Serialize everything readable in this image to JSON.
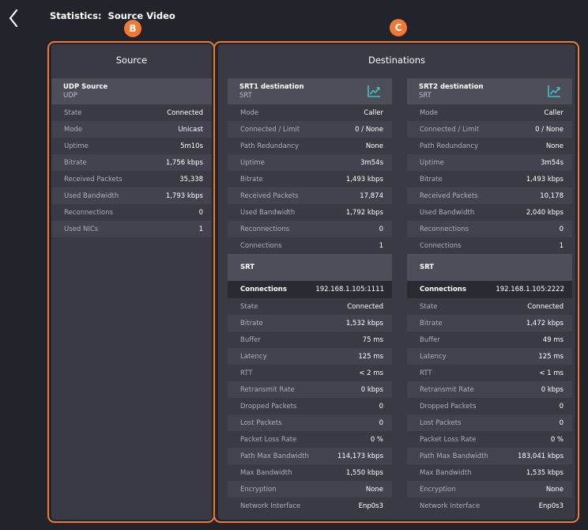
{
  "header": {
    "title_label": "Statistics:",
    "title_name": "Source Video"
  },
  "callouts": {
    "b": "B",
    "c": "C"
  },
  "colors": {
    "accent": "#f07a33",
    "chart_icon": "#37c6c6",
    "background": "#23232b"
  },
  "source": {
    "title": "Source",
    "card": {
      "name": "UDP Source",
      "type": "UDP",
      "rows": [
        {
          "label": "State",
          "value": "Connected"
        },
        {
          "label": "Mode",
          "value": "Unicast"
        },
        {
          "label": "Uptime",
          "value": "5m10s"
        },
        {
          "label": "Bitrate",
          "value": "1,756 kbps"
        },
        {
          "label": "Received Packets",
          "value": "35,338"
        },
        {
          "label": "Used Bandwidth",
          "value": "1,793 kbps"
        },
        {
          "label": "Reconnections",
          "value": "0"
        },
        {
          "label": "Used NICs",
          "value": "1"
        }
      ]
    }
  },
  "destinations": {
    "title": "Destinations",
    "items": [
      {
        "name": "SRT1 destination",
        "type": "SRT",
        "rows": [
          {
            "label": "Mode",
            "value": "Caller"
          },
          {
            "label": "Connected / Limit",
            "value": "0 / None"
          },
          {
            "label": "Path Redundancy",
            "value": "None"
          },
          {
            "label": "Uptime",
            "value": "3m54s"
          },
          {
            "label": "Bitrate",
            "value": "1,493 kbps"
          },
          {
            "label": "Received Packets",
            "value": "17,874"
          },
          {
            "label": "Used Bandwidth",
            "value": "1,792 kbps"
          },
          {
            "label": "Reconnections",
            "value": "0"
          },
          {
            "label": "Connections",
            "value": "1"
          }
        ],
        "srt_title": "SRT",
        "connection": {
          "label": "Connections",
          "value": "192.168.1.105:1111"
        },
        "srt_rows": [
          {
            "label": "State",
            "value": "Connected"
          },
          {
            "label": "Bitrate",
            "value": "1,532 kbps"
          },
          {
            "label": "Buffer",
            "value": "75 ms"
          },
          {
            "label": "Latency",
            "value": "125 ms"
          },
          {
            "label": "RTT",
            "value": "< 2 ms"
          },
          {
            "label": "Retransmit Rate",
            "value": "0 kbps"
          },
          {
            "label": "Dropped Packets",
            "value": "0"
          },
          {
            "label": "Lost Packets",
            "value": "0"
          },
          {
            "label": "Packet Loss Rate",
            "value": "0 %"
          },
          {
            "label": "Path Max Bandwidth",
            "value": "114,173 kbps"
          },
          {
            "label": "Max Bandwidth",
            "value": "1,550 kbps"
          },
          {
            "label": "Encryption",
            "value": "None"
          },
          {
            "label": "Network Interface",
            "value": "Enp0s3"
          }
        ]
      },
      {
        "name": "SRT2 destination",
        "type": "SRT",
        "rows": [
          {
            "label": "Mode",
            "value": "Caller"
          },
          {
            "label": "Connected / Limit",
            "value": "0 / None"
          },
          {
            "label": "Path Redundancy",
            "value": "None"
          },
          {
            "label": "Uptime",
            "value": "3m54s"
          },
          {
            "label": "Bitrate",
            "value": "1,493 kbps"
          },
          {
            "label": "Received Packets",
            "value": "10,178"
          },
          {
            "label": "Used Bandwidth",
            "value": "2,040 kbps"
          },
          {
            "label": "Reconnections",
            "value": "0"
          },
          {
            "label": "Connections",
            "value": "1"
          }
        ],
        "srt_title": "SRT",
        "connection": {
          "label": "Connections",
          "value": "192.168.1.105:2222"
        },
        "srt_rows": [
          {
            "label": "State",
            "value": "Connected"
          },
          {
            "label": "Bitrate",
            "value": "1,472 kbps"
          },
          {
            "label": "Buffer",
            "value": "49 ms"
          },
          {
            "label": "Latency",
            "value": "125 ms"
          },
          {
            "label": "RTT",
            "value": "< 1 ms"
          },
          {
            "label": "Retransmit Rate",
            "value": "0 kbps"
          },
          {
            "label": "Dropped Packets",
            "value": "0"
          },
          {
            "label": "Lost Packets",
            "value": "0"
          },
          {
            "label": "Packet Loss Rate",
            "value": "0 %"
          },
          {
            "label": "Path Max Bandwidth",
            "value": "183,041 kbps"
          },
          {
            "label": "Max Bandwidth",
            "value": "1,535 kbps"
          },
          {
            "label": "Encryption",
            "value": "None"
          },
          {
            "label": "Network Interface",
            "value": "Enp0s3"
          }
        ]
      }
    ]
  }
}
